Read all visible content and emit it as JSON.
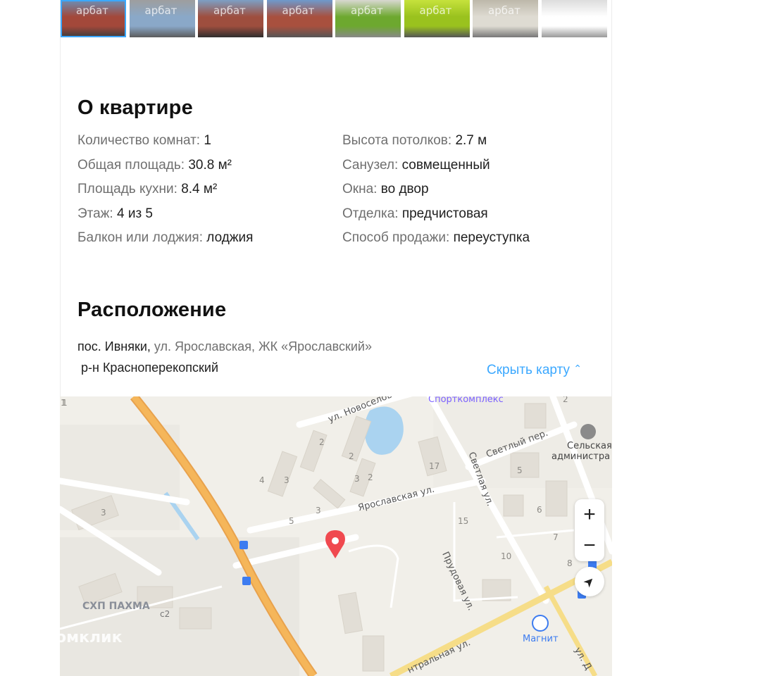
{
  "gallery": {
    "watermark": "арбат",
    "thumbnails": [
      {
        "colors": [
          "#a3483a",
          "#6a8fb8",
          "#3c3c3c"
        ],
        "active": true
      },
      {
        "colors": [
          "#8aa8c8",
          "#9e9e9e",
          "#5c5c5c"
        ],
        "active": false
      },
      {
        "colors": [
          "#9e4e3e",
          "#7d9fc4",
          "#2e2e2e"
        ],
        "active": false
      },
      {
        "colors": [
          "#a8503e",
          "#6f99cc",
          "#555555"
        ],
        "active": false
      },
      {
        "colors": [
          "#6da82f",
          "#d8d8d0",
          "#888888"
        ],
        "active": false
      },
      {
        "colors": [
          "#9ac21e",
          "#c6e23c",
          "#555555"
        ],
        "active": false
      },
      {
        "colors": [
          "#dedbd2",
          "#bdb8aa",
          "#777777"
        ],
        "active": false
      },
      {
        "colors": [
          "#ffffff",
          "#dddddd",
          "#999999"
        ],
        "active": false
      }
    ]
  },
  "about": {
    "title": "О квартире",
    "left": [
      {
        "key": "Количество комнат:",
        "value": "1"
      },
      {
        "key": "Общая площадь:",
        "value": "30.8 м²"
      },
      {
        "key": "Площадь кухни:",
        "value": "8.4 м²"
      },
      {
        "key": "Этаж:",
        "value": "4 из 5"
      },
      {
        "key": "Балкон или лоджия:",
        "value": "лоджия"
      }
    ],
    "right": [
      {
        "key": "Высота потолков:",
        "value": "2.7 м"
      },
      {
        "key": "Санузел:",
        "value": "совмещенный"
      },
      {
        "key": "Окна:",
        "value": "во двор"
      },
      {
        "key": "Отделка:",
        "value": "предчистовая"
      },
      {
        "key": "Способ продажи:",
        "value": "переуступка"
      }
    ]
  },
  "location": {
    "title": "Расположение",
    "address_settlement": "пос. Ивняки,",
    "address_street": "ул. Ярославская,",
    "address_complex": "ЖК «Ярославский»",
    "district": "р-н Красноперекопский",
    "toggle_label": "Скрыть карту",
    "toggle_icon": "chevron-up-icon"
  },
  "map": {
    "labels": {
      "novoselov": "ул. Новоселов",
      "sportkompleks": "Спорткомплекс",
      "svetly": "Светлый пер.",
      "selskaya_1": "Сельская",
      "selskaya_2": "администра",
      "svetlaya": "Светлая ул.",
      "yaroslavskaya": "Ярославская ул.",
      "prudovaya": "Прудовая ул.",
      "shp": "СХП ПАХМА",
      "magnit": "Магнит",
      "centralnaya": "нтральная ул.",
      "ul_d": "ул. Д",
      "c2": "с2"
    },
    "house_numbers": [
      "1",
      "2",
      "2",
      "3",
      "4",
      "3",
      "2",
      "3",
      "5",
      "17",
      "5",
      "15",
      "10",
      "6",
      "7",
      "8",
      "3",
      "1",
      "2"
    ],
    "controls": {
      "zoom_in": "+",
      "zoom_out": "−",
      "locate": "➤"
    },
    "watermark": "Домклик",
    "colors": {
      "highway": "#f5b65a",
      "road": "#ffffff",
      "water": "#aad3f0",
      "pin": "#f0494f",
      "poi_purple": "#7b61ff"
    }
  }
}
